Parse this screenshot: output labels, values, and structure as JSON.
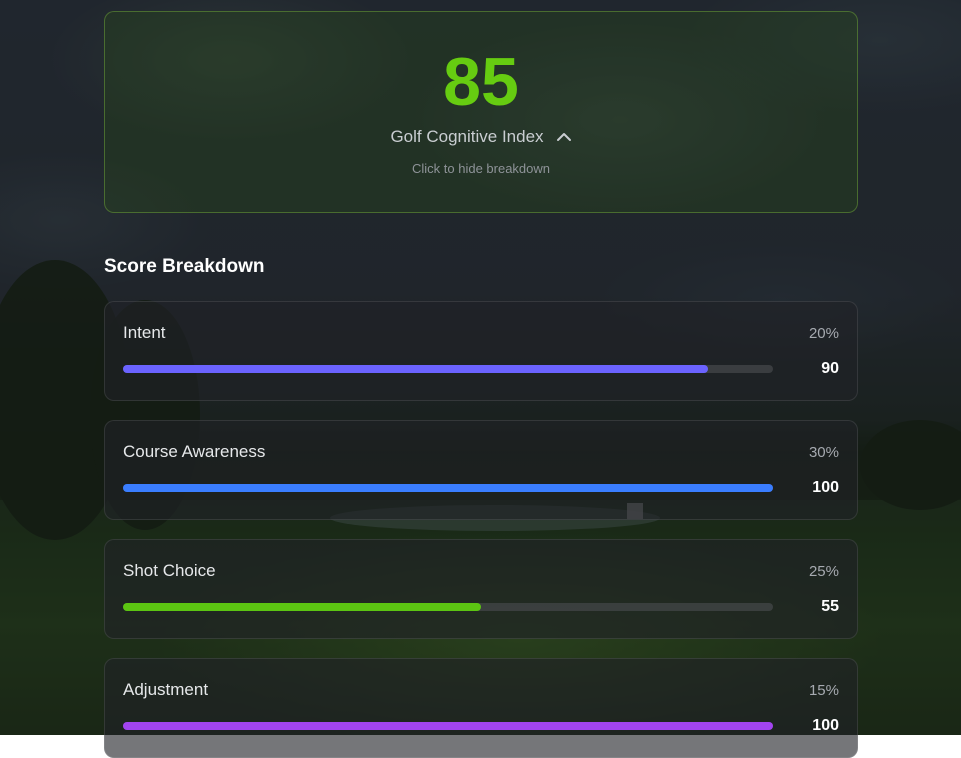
{
  "index": {
    "score": "85",
    "label": "Golf Cognitive Index",
    "hint": "Click to hide breakdown",
    "accent": "#66cc11"
  },
  "breakdown": {
    "title": "Score Breakdown",
    "items": [
      {
        "name": "Intent",
        "weight": "20%",
        "score": "90",
        "fraction": 0.9,
        "color": "#6b63ff"
      },
      {
        "name": "Course Awareness",
        "weight": "30%",
        "score": "100",
        "fraction": 1.0,
        "color": "#3a7dff"
      },
      {
        "name": "Shot Choice",
        "weight": "25%",
        "score": "55",
        "fraction": 0.55,
        "color": "#5cc512"
      },
      {
        "name": "Adjustment",
        "weight": "15%",
        "score": "100",
        "fraction": 1.0,
        "color": "#a244f0"
      }
    ]
  }
}
